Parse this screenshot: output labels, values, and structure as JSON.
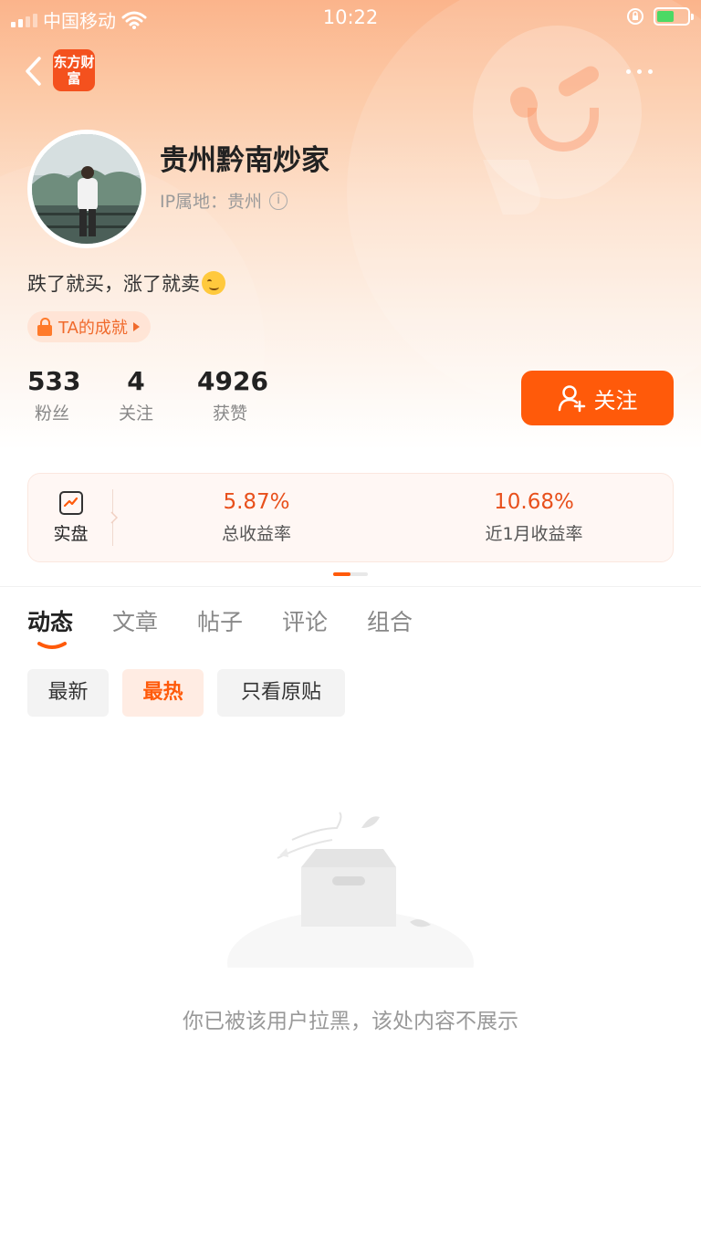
{
  "status_bar": {
    "carrier": "中国移动",
    "time": "10:22"
  },
  "nav": {
    "logo_text": "东方财富"
  },
  "profile": {
    "username": "贵州黔南炒家",
    "ip_location": "IP属地：贵州",
    "bio": "跌了就买，涨了就卖",
    "achievement_label": "TA的成就",
    "stats": [
      {
        "value": "533",
        "label": "粉丝"
      },
      {
        "value": "4",
        "label": "关注"
      },
      {
        "value": "4926",
        "label": "获赞"
      }
    ],
    "follow_button": "关注"
  },
  "earnings_card": {
    "account_type": "实盘",
    "metrics": [
      {
        "value": "5.87%",
        "label": "总收益率"
      },
      {
        "value": "10.68%",
        "label": "近1月收益率"
      }
    ]
  },
  "tabs": [
    "动态",
    "文章",
    "帖子",
    "评论",
    "组合"
  ],
  "active_tab": "动态",
  "filters": [
    "最新",
    "最热",
    "只看原贴"
  ],
  "active_filter": "最热",
  "empty_state": {
    "message": "你已被该用户拉黑，该处内容不展示"
  },
  "colors": {
    "accent": "#ff5a0a",
    "metric_value": "#e8501c",
    "header_gradient_top": "#fbb48b"
  }
}
